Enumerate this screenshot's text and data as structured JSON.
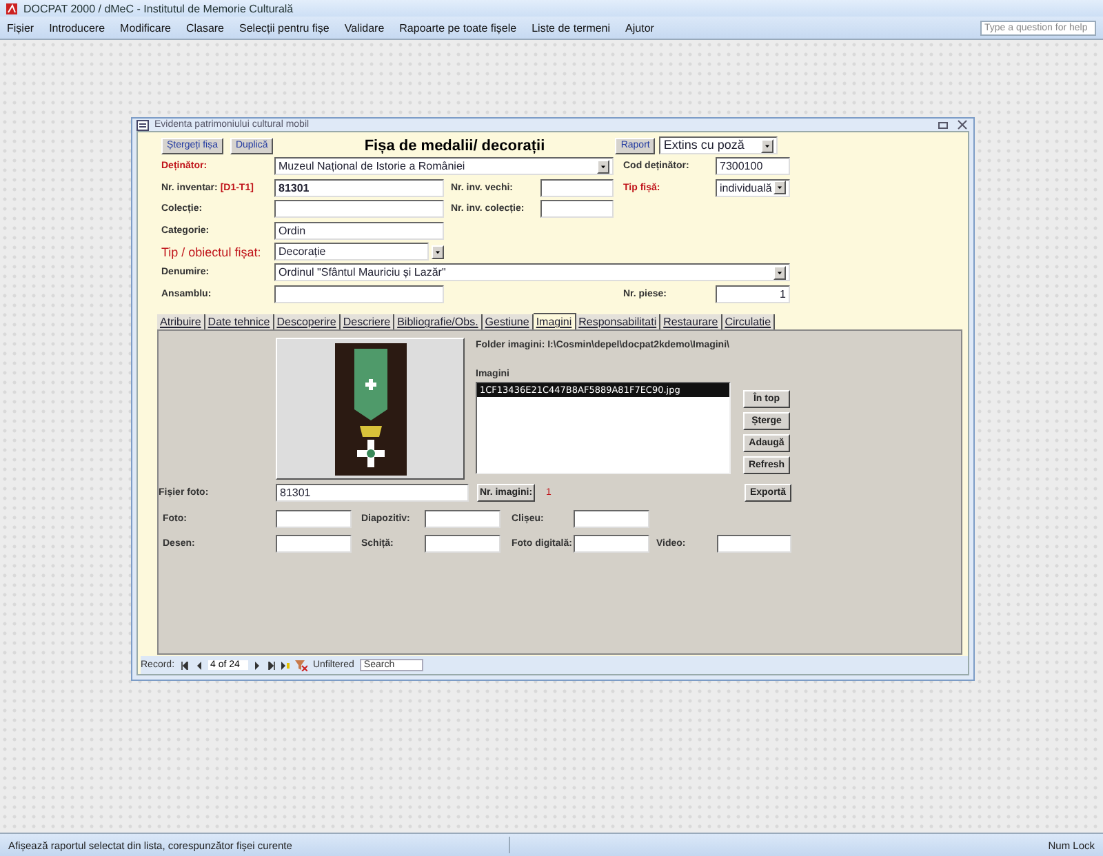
{
  "app": {
    "title": "DOCPAT 2000 / dMeC - Institutul de Memorie Culturală",
    "help_placeholder": "Type a question for help"
  },
  "menu": [
    "Fișier",
    "Introducere",
    "Modificare",
    "Clasare",
    "Selecții pentru fișe",
    "Validare",
    "Rapoarte pe toate fișele",
    "Liste de termeni",
    "Ajutor"
  ],
  "form": {
    "title": "Evidenta patrimoniului cultural mobil",
    "buttons": [
      "Ștergeți fișa",
      "Duplică"
    ],
    "heading": "Fișa de medalii/ decorații",
    "report_button": "Raport",
    "report_combo": "Extins cu poză",
    "fields": [
      {
        "label": "Deținător:",
        "required": true,
        "emphasis": false,
        "kind": "combo",
        "value": "Muzeul Național de Istorie a României"
      },
      {
        "label": "Cod deținător:",
        "required": false,
        "emphasis": false,
        "kind": "text",
        "value": "7300100"
      },
      {
        "label": "Nr. inventar:",
        "tag": "[D1-T1]",
        "required": false,
        "emphasis": false,
        "kind": "text",
        "value": "81301"
      },
      {
        "label": "Nr. inv. vechi:",
        "required": false,
        "emphasis": false,
        "kind": "text"
      },
      {
        "label": "Tip fișă:",
        "required": true,
        "emphasis": false,
        "kind": "combo",
        "value": "individuală"
      },
      {
        "label": "Colecție:",
        "required": false,
        "emphasis": false,
        "kind": "text"
      },
      {
        "label": "Nr. inv. colecție:",
        "required": false,
        "emphasis": false,
        "kind": "text"
      },
      {
        "label": "Categorie:",
        "required": false,
        "emphasis": false,
        "kind": "text",
        "value": "Ordin"
      },
      {
        "label": "Tip / obiectul fișat:",
        "required": true,
        "emphasis": true,
        "kind": "combo",
        "value": "Decorație"
      },
      {
        "label": "Denumire:",
        "required": false,
        "emphasis": false,
        "kind": "combo",
        "value": "Ordinul \"Sfântul Mauriciu și Lazăr\""
      },
      {
        "label": "Ansamblu:",
        "required": false,
        "emphasis": false,
        "kind": "text"
      },
      {
        "label": "Nr. piese:",
        "required": false,
        "emphasis": false,
        "kind": "number",
        "value": "1"
      }
    ],
    "tabs": [
      {
        "label": "Atribuire",
        "selected": false
      },
      {
        "label": "Date tehnice",
        "selected": false
      },
      {
        "label": "Descoperire",
        "selected": false
      },
      {
        "label": "Descriere",
        "selected": false
      },
      {
        "label": "Bibliografie/Obs.",
        "selected": false
      },
      {
        "label": "Gestiune",
        "selected": false
      },
      {
        "label": "Imagini",
        "selected": true
      },
      {
        "label": "Responsabilitati",
        "selected": false
      },
      {
        "label": "Restaurare",
        "selected": false
      },
      {
        "label": "Circulatie",
        "selected": false
      }
    ],
    "images": {
      "folder": "Folder imagini: I:\\Cosmin\\depel\\docpat2kdemo\\Imagini\\",
      "list_label": "Imagini",
      "files": [
        {
          "name": "1CF13436E21C447B8AF5889A81F7EC90.jpg",
          "selected": true
        }
      ],
      "side_buttons": [
        "În top",
        "Șterge",
        "Adaugă",
        "Refresh"
      ],
      "photo_file_label": "Fișier foto:",
      "photo_file": "81301",
      "count_button": "Nr. imagini:",
      "count": "1",
      "export_button": "Exportă",
      "media_fields": [
        {
          "label": "Foto:"
        },
        {
          "label": "Diapozitiv:"
        },
        {
          "label": "Clișeu:"
        },
        {
          "label": "Desen:"
        },
        {
          "label": "Schiță:"
        },
        {
          "label": "Foto digitală:"
        },
        {
          "label": "Video:"
        }
      ]
    },
    "record_bar": {
      "label": "Record:",
      "position": "4 of 24",
      "filter": "Unfiltered",
      "search": "Search"
    }
  },
  "status_bar": {
    "message": "Afișează raportul selectat din lista, corespunzător fișei curente",
    "indicator": "Num Lock"
  }
}
